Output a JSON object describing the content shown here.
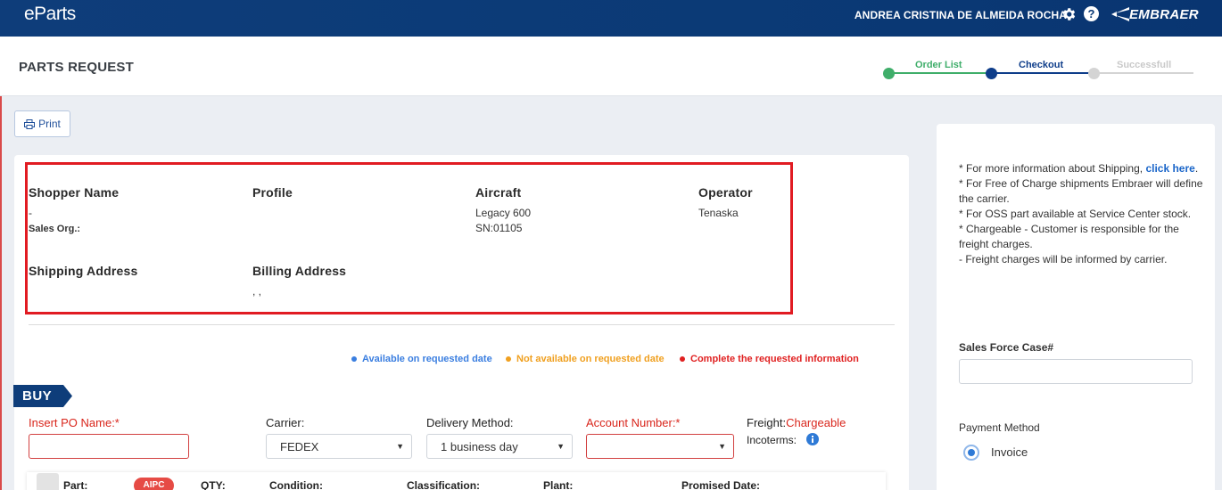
{
  "app": {
    "name": "eParts",
    "user": "ANDREA CRISTINA DE ALMEIDA ROCHA",
    "brand": "EMBRAER"
  },
  "header": {
    "title": "PARTS REQUEST"
  },
  "stepper": {
    "steps": [
      {
        "label": "Order List",
        "state": "done",
        "color": "#3fae6a"
      },
      {
        "label": "Checkout",
        "state": "current",
        "color": "#0e3d8a"
      },
      {
        "label": "Successfull",
        "state": "pending",
        "color": "#c9c9c9"
      }
    ]
  },
  "toolbar": {
    "print_label": "Print"
  },
  "info": {
    "shopper_label": "Shopper Name",
    "shopper_value": "-",
    "sales_org_label": "Sales Org.:",
    "profile_label": "Profile",
    "aircraft_label": "Aircraft",
    "aircraft_model": "Legacy 600",
    "aircraft_sn": "SN:01105",
    "operator_label": "Operator",
    "operator_value": "Tenaska",
    "shipping_label": "Shipping Address",
    "billing_label": "Billing Address",
    "billing_value": ", ,"
  },
  "legend": [
    {
      "label": "Available on requested date",
      "color": "#3a7ee0"
    },
    {
      "label": "Not available on requested date",
      "color": "#f0a020"
    },
    {
      "label": "Complete the requested information",
      "color": "#e02020"
    }
  ],
  "buy": {
    "tag": "BUY",
    "po_label": "Insert PO Name:*",
    "po_value": "",
    "carrier_label": "Carrier:",
    "carrier_value": "FEDEX",
    "delivery_label": "Delivery Method:",
    "delivery_value": "1 business day",
    "account_label": "Account Number:*",
    "account_value": "",
    "freight_label": "Freight:",
    "freight_value": "Chargeable",
    "incoterms_label": "Incoterms:"
  },
  "parts_table": {
    "part": "Part:",
    "badge": "AIPC",
    "qty": "QTY:",
    "condition": "Condition:",
    "classification": "Classification:",
    "plant": "Plant:",
    "promised": "Promised Date:"
  },
  "side": {
    "note1_text": "* For more information about Shipping, ",
    "note1_link": "click here",
    "note2": "* For Free of Charge shipments Embraer will define the carrier.",
    "note3": "* For OSS part available at Service Center stock.",
    "note4": "* Chargeable - Customer is responsible for the freight charges.",
    "note5": "- Freight charges will be informed by carrier.",
    "sf_label": "Sales Force Case#",
    "sf_value": "",
    "payment_label": "Payment Method",
    "payment_option": "Invoice"
  }
}
